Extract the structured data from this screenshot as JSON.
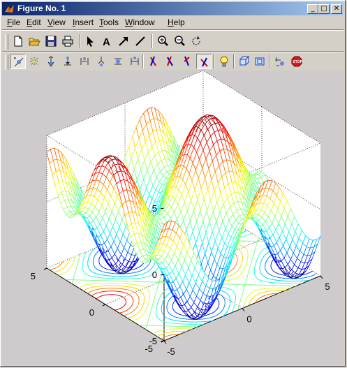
{
  "window": {
    "title": "Figure No. 1"
  },
  "menu": [
    {
      "label": "File",
      "ul": "F"
    },
    {
      "label": "Edit",
      "ul": "E"
    },
    {
      "label": "View",
      "ul": "V"
    },
    {
      "label": "Insert",
      "ul": "I"
    },
    {
      "label": "Tools",
      "ul": "T"
    },
    {
      "label": "Window",
      "ul": "W"
    },
    {
      "label": "Help",
      "ul": "H"
    }
  ],
  "toolbar1": [
    "new-file-icon",
    "open-folder-icon",
    "save-icon",
    "print-icon",
    "select-arrow-icon",
    "insert-text-icon",
    "insert-arrow-icon",
    "insert-line-icon",
    "zoom-in-icon",
    "zoom-out-icon",
    "rotate-3d-icon"
  ],
  "toolbar2": [
    "camera-orbit-icon",
    "camera-orbit-light-icon",
    "camera-pitch-icon",
    "camera-dolly-icon",
    "camera-walk-icon",
    "camera-zoom-icon",
    "camera-roll-icon",
    "camera-move-icon",
    "principal-axis-x-icon",
    "principal-axis-y-icon",
    "principal-axis-z-icon",
    "principal-axis-none-icon",
    "light-bulb-icon",
    "projection-orthographic-icon",
    "projection-perspective-icon",
    "reset-camera-icon",
    "stop-icon"
  ],
  "chart_data": {
    "type": "surface-with-contour",
    "title": "",
    "xlabel": "",
    "ylabel": "",
    "zlabel": "",
    "xlim": [
      -5,
      5
    ],
    "ylim": [
      -5,
      5
    ],
    "zlim": [
      -5,
      5
    ],
    "x_ticks": [
      "-5",
      "0",
      "5"
    ],
    "y_ticks": [
      "-5",
      "0",
      "5"
    ],
    "z_ticks": [
      "-5",
      "0",
      "5"
    ],
    "surface_function": "z = 3*sin(x) + 3*cos(y)",
    "colormap": "jet",
    "grid": true,
    "box": true
  },
  "colors": {
    "figure_bg": "#cfcbcc",
    "title_start": "#0a246a",
    "title_end": "#a6caf0"
  }
}
